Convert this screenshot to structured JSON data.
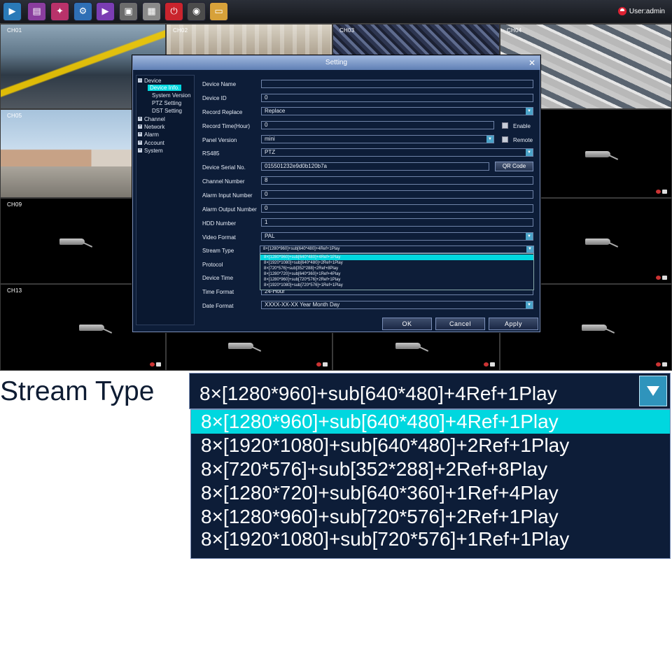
{
  "taskbar": {
    "icons": [
      {
        "name": "live-view-icon",
        "color": "#2a7ab8"
      },
      {
        "name": "playback-film-icon",
        "color": "#8a3d9e"
      },
      {
        "name": "alarm-icon",
        "color": "#b8326a"
      },
      {
        "name": "settings-gear-icon",
        "color": "#2f6fb5"
      },
      {
        "name": "play-icon",
        "color": "#7b3db3"
      },
      {
        "name": "save-disk-icon",
        "color": "#6c6c6c"
      },
      {
        "name": "keyboard-icon",
        "color": "#8a8a8a"
      },
      {
        "name": "power-icon",
        "color": "#c9242d"
      },
      {
        "name": "camera-snapshot-icon",
        "color": "#4c4c4c"
      },
      {
        "name": "folder-icon",
        "color": "#d7a13a"
      }
    ],
    "user_label": "User:admin"
  },
  "cells": [
    {
      "label": "CH01",
      "feed": "garage"
    },
    {
      "label": "CH02",
      "feed": "hall"
    },
    {
      "label": "CH03",
      "feed": "crowd"
    },
    {
      "label": "CH04",
      "feed": "parking"
    },
    {
      "label": "CH05",
      "feed": "building"
    },
    {
      "label": "CH09",
      "feed": "dark"
    },
    {
      "label": "CH13",
      "feed": "dark"
    }
  ],
  "dialog": {
    "title": "Setting",
    "close_symbol": "✕",
    "tree": {
      "device": "Device",
      "device_info": "Device Info.",
      "system_version": "System Version",
      "ptz_setting": "PTZ Setting",
      "dst_setting": "DST Setting",
      "channel": "Channel",
      "network": "Network",
      "alarm": "Alarm",
      "account": "Account",
      "system": "System"
    },
    "fields": {
      "device_name": {
        "label": "Device Name",
        "value": ""
      },
      "device_id": {
        "label": "Device ID",
        "value": "0"
      },
      "record_replace": {
        "label": "Record Replace",
        "value": "Replace"
      },
      "record_time": {
        "label": "Record Time(Hour)",
        "value": "0",
        "check_label": "Enable"
      },
      "panel_version": {
        "label": "Panel Version",
        "value": "mini",
        "check_label": "Remote"
      },
      "rs485": {
        "label": "RS485",
        "value": "PTZ"
      },
      "serial": {
        "label": "Device Serial No.",
        "value": "015501232e9d0b120b7a",
        "button": "QR Code"
      },
      "channel_number": {
        "label": "Channel Number",
        "value": "8"
      },
      "alarm_input": {
        "label": "Alarm Input Number",
        "value": "0"
      },
      "alarm_output": {
        "label": "Alarm Output Number",
        "value": "0"
      },
      "hdd_number": {
        "label": "HDD Number",
        "value": "1"
      },
      "video_format": {
        "label": "Video Format",
        "value": "PAL"
      },
      "stream_type": {
        "label": "Stream Type",
        "value": "8×[1280*960]+sub[640*480]+4Ref+1Play"
      },
      "protocol": {
        "label": "Protocol"
      },
      "device_time": {
        "label": "Device Time"
      },
      "time_format": {
        "label": "Time Format",
        "value": "24-Hour"
      },
      "date_format": {
        "label": "Date Format",
        "value": "XXXX-XX-XX Year Month Day"
      }
    },
    "buttons": {
      "ok": "OK",
      "cancel": "Cancel",
      "apply": "Apply"
    }
  },
  "stream_options": [
    "8×[1280*960]+sub[640*480]+4Ref+1Play",
    "8×[1920*1080]+sub[640*480]+2Ref+1Play",
    "8×[720*576]+sub[352*288]+2Ref+8Play",
    "8×[1280*720]+sub[640*360]+1Ref+4Play",
    "8×[1280*960]+sub[720*576]+2Ref+1Play",
    "8×[1920*1080]+sub[720*576]+1Ref+1Play"
  ],
  "zoom": {
    "label": "Stream Type",
    "selected": "8×[1280*960]+sub[640*480]+4Ref+1Play"
  },
  "colors": {
    "highlight": "#00d7df",
    "panel": "#0d1d38"
  }
}
